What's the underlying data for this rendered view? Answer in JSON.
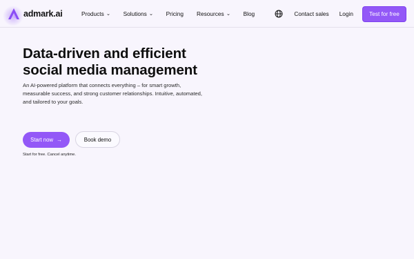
{
  "brand": {
    "name": "admark.ai",
    "accent": "#9358f7"
  },
  "nav": {
    "items": [
      {
        "label": "Products",
        "dropdown": true
      },
      {
        "label": "Solutions",
        "dropdown": true
      },
      {
        "label": "Pricing",
        "dropdown": false
      },
      {
        "label": "Resources",
        "dropdown": true
      },
      {
        "label": "Blog",
        "dropdown": false
      }
    ],
    "contact": "Contact sales",
    "login": "Login",
    "cta": "Test for free"
  },
  "hero": {
    "title": "Data-driven and efficient social media management",
    "subtitle": "An AI-powered platform that connects everything – for smart growth, measurable success, and strong customer relationships. Intuitive, automated, and tailored to your goals.",
    "primary_button": "Start now",
    "secondary_button": "Book demo",
    "note": "Start for free. Cancel anytime."
  }
}
